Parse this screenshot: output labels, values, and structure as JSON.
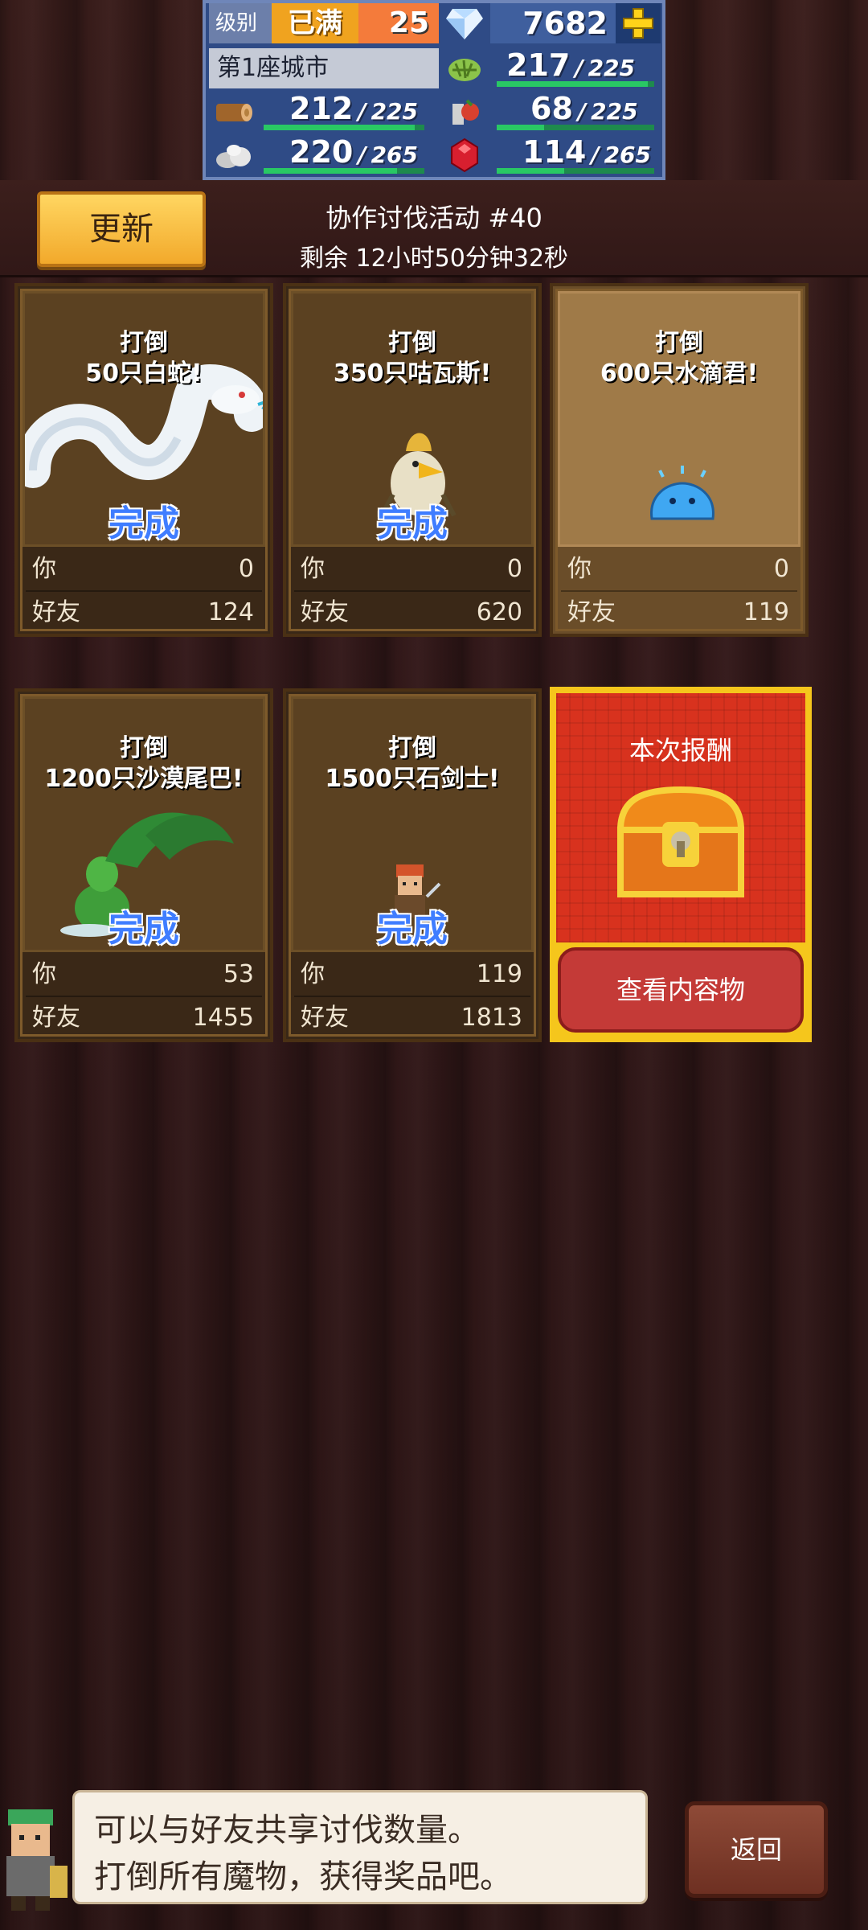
{
  "status_bar": {
    "level_label": "级别",
    "level_status": "已满",
    "level_value": "25",
    "gems": "7682",
    "city_name": "第1座城市",
    "resources": [
      {
        "icon": "grass-icon",
        "current": "217",
        "max": "225",
        "fill": 0.96
      },
      {
        "icon": "wood-log-icon",
        "current": "212",
        "max": "225",
        "fill": 0.94
      },
      {
        "icon": "food-icon",
        "current": "68",
        "max": "225",
        "fill": 0.3
      },
      {
        "icon": "stone-icon",
        "current": "220",
        "max": "265",
        "fill": 0.83
      },
      {
        "icon": "ruby-icon",
        "current": "114",
        "max": "265",
        "fill": 0.43
      }
    ]
  },
  "header": {
    "update_label": "更新",
    "event_title": "协作讨伐活动 #40",
    "timer": "剩余 12小时50分钟32秒"
  },
  "missions": [
    {
      "line1": "打倒",
      "line2": "50只白蛇!",
      "done": "完成",
      "you_label": "你",
      "you": "0",
      "friend_label": "好友",
      "friend": "124",
      "monster": "white-snake-icon"
    },
    {
      "line1": "打倒",
      "line2": "350只咕瓦斯!",
      "done": "完成",
      "you_label": "你",
      "you": "0",
      "friend_label": "好友",
      "friend": "620",
      "monster": "bird-monster-icon"
    },
    {
      "line1": "打倒",
      "line2": "600只水滴君!",
      "done": "",
      "you_label": "你",
      "you": "0",
      "friend_label": "好友",
      "friend": "119",
      "monster": "water-drop-slime-icon"
    },
    {
      "line1": "打倒",
      "line2": "1200只沙漠尾巴!",
      "done": "完成",
      "you_label": "你",
      "you": "53",
      "friend_label": "好友",
      "friend": "1455",
      "monster": "desert-plant-icon"
    },
    {
      "line1": "打倒",
      "line2": "1500只石剑士!",
      "done": "完成",
      "you_label": "你",
      "you": "119",
      "friend_label": "好友",
      "friend": "1813",
      "monster": "stone-swordsman-icon"
    }
  ],
  "reward": {
    "title": "本次报酬",
    "view_label": "查看内容物",
    "icon": "treasure-chest-icon"
  },
  "dialog": {
    "line1": "可以与好友共享讨伐数量。",
    "line2": "打倒所有魔物，获得奖品吧。"
  },
  "back_label": "返回",
  "colors": {
    "accent_gold": "#f5c61c",
    "reward_red": "#d8321e",
    "done_blue": "#3f7dff",
    "bar_green": "#29c864"
  }
}
